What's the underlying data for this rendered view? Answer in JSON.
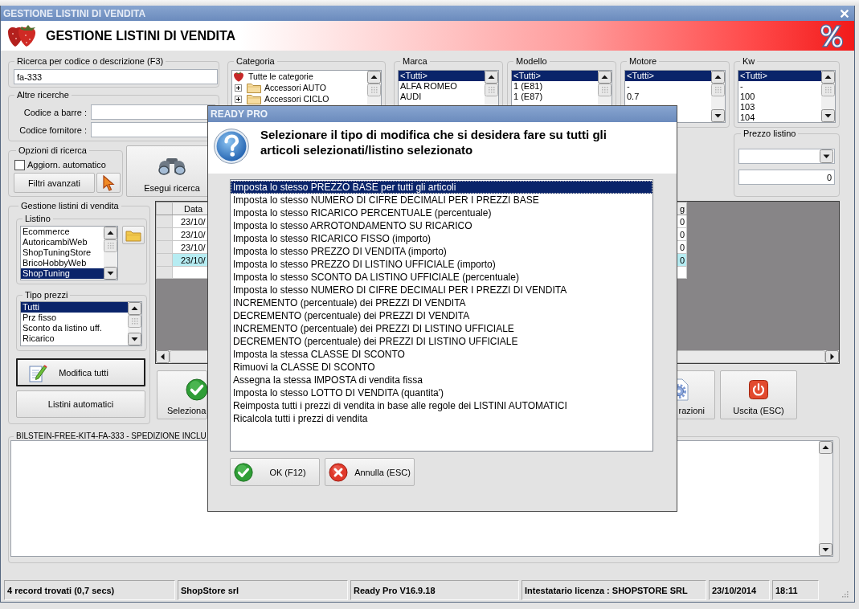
{
  "window": {
    "title": "GESTIONE LISTINI DI VENDITA"
  },
  "header": {
    "title": "GESTIONE LISTINI DI VENDITA"
  },
  "search": {
    "label": "Ricerca per codice o descrizione (F3)",
    "value": "fa-333"
  },
  "other_searches": {
    "label": "Altre ricerche",
    "fields": [
      {
        "label": "Codice a barre :"
      },
      {
        "label": "Codice fornitore :"
      }
    ]
  },
  "search_options": {
    "label": "Opzioni di ricerca",
    "auto_update": {
      "label": "Aggiorn. automatico",
      "checked": false
    },
    "advanced_filters_button": "Filtri avanzati"
  },
  "run_search_button": "Esegui ricerca",
  "category": {
    "label": "Categoria",
    "tree": [
      {
        "label": "Tutte le categorie",
        "children": [
          {
            "label": "Accessori AUTO",
            "expanded": false
          },
          {
            "label": "Accessori CICLO",
            "expanded": false
          }
        ]
      }
    ]
  },
  "filter_lists": [
    {
      "label": "Marca",
      "items": [
        {
          "label": "<Tutti>",
          "selected": true
        },
        {
          "label": "ALFA ROMEO",
          "selected": false
        },
        {
          "label": "AUDI",
          "selected": false
        }
      ]
    },
    {
      "label": "Modello",
      "items": [
        {
          "label": "<Tutti>",
          "selected": true
        },
        {
          "label": "1 (E81)",
          "selected": false
        },
        {
          "label": "1 (E87)",
          "selected": false
        }
      ]
    },
    {
      "label": "Motore",
      "items": [
        {
          "label": "<Tutti>",
          "selected": true
        },
        {
          "label": "-",
          "selected": false
        },
        {
          "label": "0.7",
          "selected": false
        }
      ]
    }
  ],
  "kw": {
    "label": "Kw",
    "items": [
      {
        "label": "<Tutti>",
        "selected": true
      },
      {
        "label": "-",
        "selected": false
      },
      {
        "label": "100",
        "selected": false
      },
      {
        "label": "103",
        "selected": false
      },
      {
        "label": "104",
        "selected": false
      }
    ]
  },
  "list_price": {
    "label": "Prezzo listino",
    "value": "0"
  },
  "pricelist_management": {
    "label": "Gestione listini di vendita",
    "pricelists": {
      "label": "Listino",
      "items": [
        {
          "label": "Ecommerce",
          "selected": false
        },
        {
          "label": "AutoricambiWeb",
          "selected": false
        },
        {
          "label": "ShopTuningStore",
          "selected": false
        },
        {
          "label": "BricoHobbyWeb",
          "selected": false
        },
        {
          "label": "ShopTuning",
          "selected": true
        }
      ]
    },
    "price_types": {
      "label": "Tipo prezzi",
      "items": [
        {
          "label": "Tutti",
          "selected": true
        },
        {
          "label": "Prz fisso",
          "selected": false
        },
        {
          "label": "Sconto da listino uff.",
          "selected": false
        },
        {
          "label": "Ricarico",
          "selected": false
        }
      ]
    },
    "buttons": [
      {
        "label": "Modifica tutti",
        "default": true
      },
      {
        "label": "Listini automatici",
        "default": false
      }
    ]
  },
  "grid": {
    "columns": {
      "column_1": "Data",
      "column_2": "g"
    },
    "rows": [
      {
        "column_1": "23/10/",
        "column_2": "0",
        "selected": false
      },
      {
        "column_1": "23/10/",
        "column_2": "0",
        "selected": false
      },
      {
        "column_1": "23/10/",
        "column_2": "0",
        "selected": false
      },
      {
        "column_1": "23/10/",
        "column_2": "0",
        "selected": true
      }
    ]
  },
  "action_buttons": [
    {
      "kind": "select",
      "label": "Seleziona"
    },
    {
      "kind": "settings",
      "label": "razioni"
    },
    {
      "kind": "exit",
      "label": "Uscita (ESC)"
    }
  ],
  "notes": {
    "label": "BILSTEIN-FREE-KIT4-FA-333 - SPEDIZIONE INCLU"
  },
  "status_bar": [
    "4 record trovati (0,7 secs)",
    "ShopStore srl",
    "Ready Pro V16.9.18",
    "Intestatario licenza : SHOPSTORE SRL",
    "23/10/2014",
    "18:11"
  ],
  "dialog": {
    "title": "READY PRO",
    "message": "Selezionare il tipo di modifica che si desidera fare su tutti gli articoli selezionati/listino selezionato",
    "options": [
      {
        "label": "Imposta lo stesso PREZZO BASE per tutti gli articoli",
        "selected": true
      },
      {
        "label": "Imposta lo stesso NUMERO DI CIFRE DECIMALI PER I PREZZI BASE",
        "selected": false
      },
      {
        "label": "Imposta lo stesso RICARICO PERCENTUALE (percentuale)",
        "selected": false
      },
      {
        "label": "Imposta lo stesso ARROTONDAMENTO SU RICARICO",
        "selected": false
      },
      {
        "label": "Imposta lo stesso RICARICO FISSO (importo)",
        "selected": false
      },
      {
        "label": "Imposta lo stesso PREZZO DI VENDITA (importo)",
        "selected": false
      },
      {
        "label": "Imposta lo stesso PREZZO DI LISTINO UFFICIALE (importo)",
        "selected": false
      },
      {
        "label": "Imposta lo stesso SCONTO DA LISTINO UFFICIALE (percentuale)",
        "selected": false
      },
      {
        "label": "Imposta lo stesso NUMERO DI CIFRE DECIMALI PER I PREZZI DI VENDITA",
        "selected": false
      },
      {
        "label": "INCREMENTO (percentuale) dei PREZZI DI VENDITA",
        "selected": false
      },
      {
        "label": "DECREMENTO (percentuale) dei PREZZI DI VENDITA",
        "selected": false
      },
      {
        "label": "INCREMENTO (percentuale) dei PREZZI DI LISTINO UFFICIALE",
        "selected": false
      },
      {
        "label": "DECREMENTO (percentuale) dei PREZZI DI LISTINO UFFICIALE",
        "selected": false
      },
      {
        "label": "Imposta la stessa CLASSE DI SCONTO",
        "selected": false
      },
      {
        "label": "Rimuovi la CLASSE DI SCONTO",
        "selected": false
      },
      {
        "label": "Assegna la stessa IMPOSTA di vendita fissa",
        "selected": false
      },
      {
        "label": "Imposta lo stesso LOTTO DI VENDITA (quantita')",
        "selected": false
      },
      {
        "label": "Reimposta tutti i prezzi di vendita in base alle regole dei LISTINI AUTOMATICI",
        "selected": false
      },
      {
        "label": "Ricalcola tutti i prezzi di vendita",
        "selected": false
      }
    ],
    "buttons": [
      {
        "kind": "ok",
        "label": "OK (F12)"
      },
      {
        "kind": "cancel",
        "label": "Annulla (ESC)"
      }
    ]
  }
}
